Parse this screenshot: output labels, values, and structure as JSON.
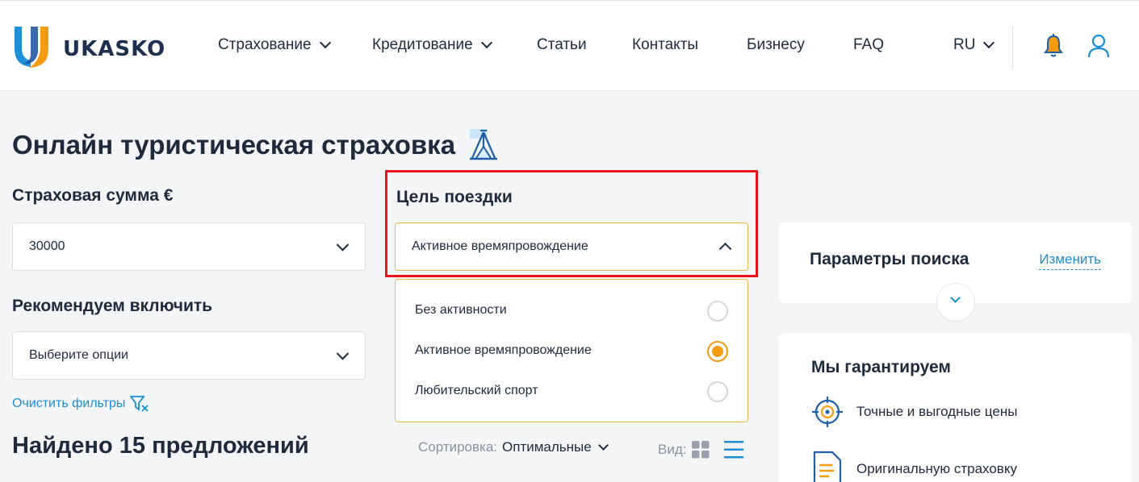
{
  "header": {
    "logo_text": "UKASKO",
    "nav": [
      {
        "label": "Страхование",
        "has_dropdown": true
      },
      {
        "label": "Кредитование",
        "has_dropdown": true
      },
      {
        "label": "Статьи",
        "has_dropdown": false
      },
      {
        "label": "Контакты",
        "has_dropdown": false
      },
      {
        "label": "Бизнесу",
        "has_dropdown": false
      },
      {
        "label": "FAQ",
        "has_dropdown": false
      }
    ],
    "language": "RU",
    "icons": [
      "bell-icon",
      "user-icon"
    ]
  },
  "page": {
    "title": "Онлайн туристическая страховка",
    "title_icon": "tent-icon"
  },
  "filters": {
    "sum": {
      "label": "Страховая сумма €",
      "value": "30000"
    },
    "recommend": {
      "label": "Рекомендуем включить",
      "placeholder": "Выберите опции"
    },
    "purpose": {
      "label": "Цель поездки",
      "value": "Активное времяпровождение",
      "open": true,
      "options": [
        {
          "label": "Без активности",
          "selected": false
        },
        {
          "label": "Активное времяпровождение",
          "selected": true
        },
        {
          "label": "Любительский спорт",
          "selected": false
        }
      ]
    },
    "clear_label": "Очистить фильтры"
  },
  "results": {
    "found_prefix": "Найдено",
    "found_count": "15",
    "found_suffix": "предложений",
    "sort_label": "Сортировка:",
    "sort_value": "Оптимальные",
    "view_label": "Вид:"
  },
  "sidebar": {
    "params_title": "Параметры поиска",
    "change_label": "Изменить",
    "guarantee_title": "Мы гарантируем",
    "guarantees": [
      {
        "icon": "target-icon",
        "label": "Точные и выгодные цены"
      },
      {
        "icon": "document-icon",
        "label": "Оригинальную страховку"
      }
    ]
  },
  "colors": {
    "accent_blue": "#1a8fd4",
    "accent_orange": "#f39c12",
    "highlight_red": "#e8141b",
    "text_dark": "#1f2a3c"
  }
}
